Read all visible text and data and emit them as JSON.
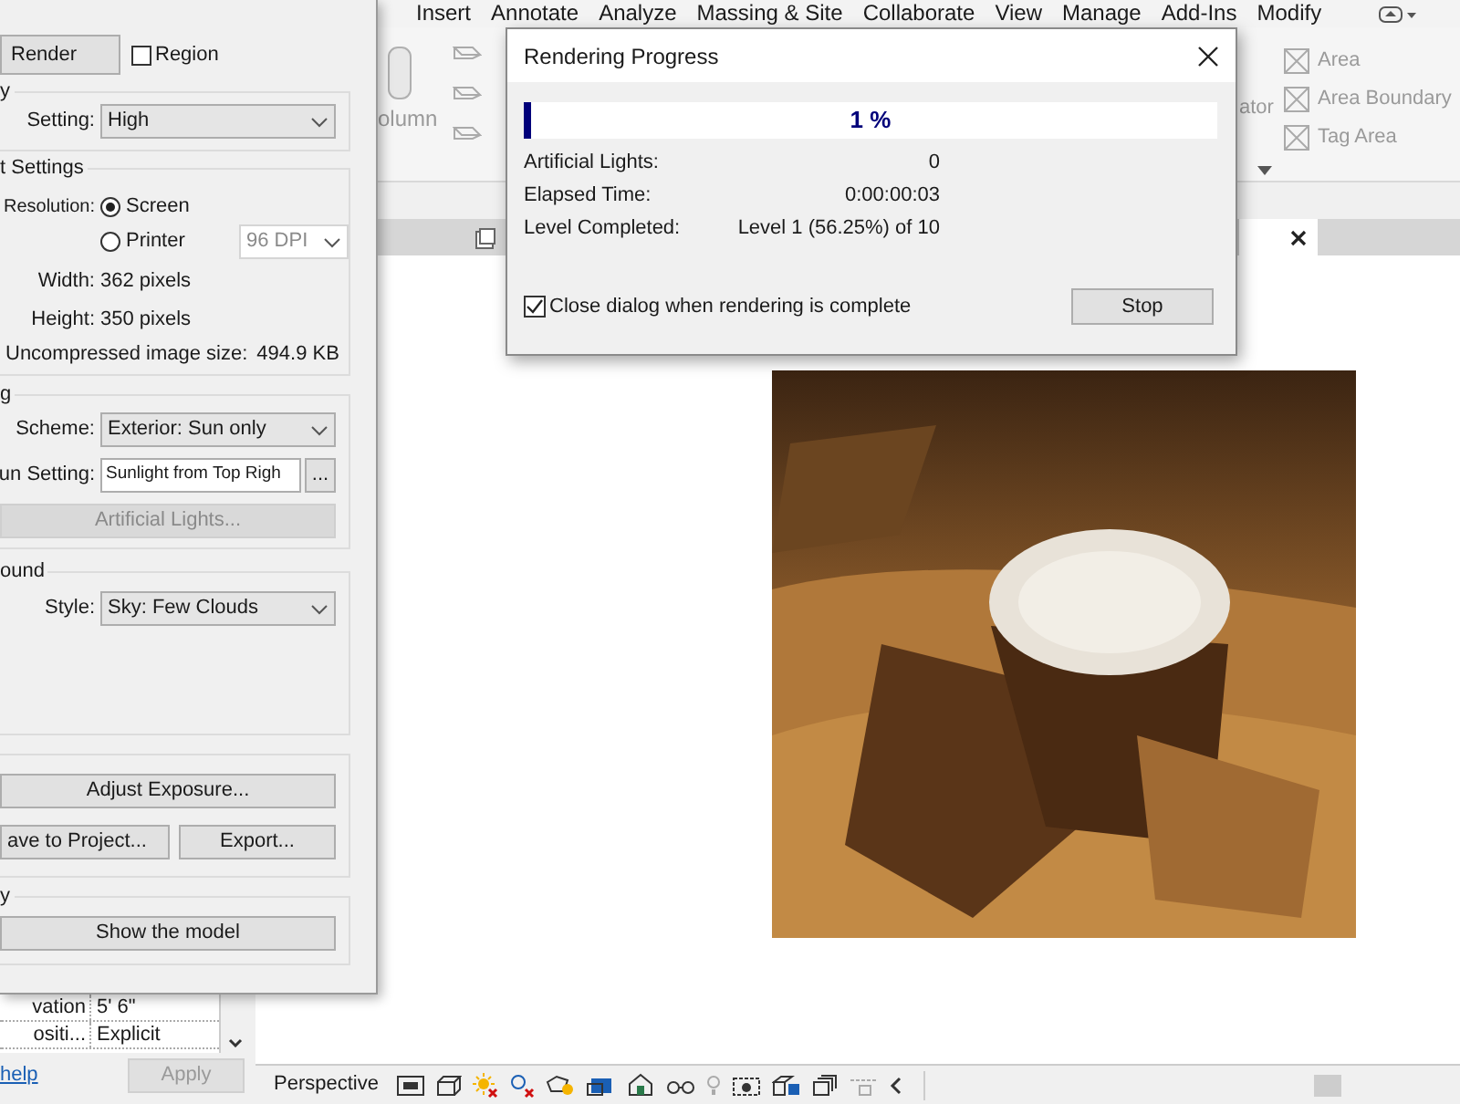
{
  "ribbon_tabs": [
    "Insert",
    "Annotate",
    "Analyze",
    "Massing & Site",
    "Collaborate",
    "View",
    "Manage",
    "Add-Ins",
    "Modify"
  ],
  "ribbon_left": {
    "column": "olumn"
  },
  "ribbon_right": {
    "cut_label": "ator",
    "area_tools": [
      "Area",
      "Area Boundary",
      "Tag Area"
    ]
  },
  "view_bar": {
    "label": "Perspective"
  },
  "properties": {
    "rows": [
      {
        "name": "vation",
        "value": "5'  6\""
      },
      {
        "name": "ositi...",
        "value": "Explicit"
      }
    ],
    "help_link": "help",
    "apply": {
      "label": "Apply",
      "disabled": true
    }
  },
  "render_dialog": {
    "render_button": "Render",
    "region": {
      "label": "Region",
      "checked": false
    },
    "quality": {
      "title": "y",
      "setting_label": "Setting:",
      "setting": "High"
    },
    "output": {
      "title": "t Settings",
      "resolution_label": "Resolution:",
      "options": [
        {
          "label": "Screen",
          "selected": true
        },
        {
          "label": "Printer",
          "selected": false
        }
      ],
      "dpi": {
        "value": "96 DPI",
        "disabled": true
      },
      "width_label": "Width:",
      "width": "362 pixels",
      "height_label": "Height:",
      "height": "350 pixels",
      "size_label": "Uncompressed image size:",
      "size": "494.9 KB"
    },
    "lighting": {
      "title": "g",
      "scheme_label": "Scheme:",
      "scheme": "Exterior: Sun only",
      "sun_label": "un Setting:",
      "sun": "Sunlight from Top Righ",
      "browse": "...",
      "artificial_lights": {
        "label": "Artificial Lights...",
        "disabled": true
      }
    },
    "background": {
      "title": "ound",
      "style_label": "Style:",
      "style": "Sky: Few Clouds"
    },
    "image": {
      "buttons": [
        "Adjust Exposure...",
        "ave to Project...",
        "Export..."
      ]
    },
    "display": {
      "title": "y",
      "button": "Show the model"
    }
  },
  "progress_dialog": {
    "title": "Rendering Progress",
    "progress": {
      "level": 0.01,
      "text": "1 %"
    },
    "rows": [
      {
        "label": "Artificial Lights:",
        "value": "0"
      },
      {
        "label": "Elapsed Time:",
        "value": "0:00:00:03"
      },
      {
        "label": "Level Completed:",
        "value": "Level 1 (56.25%) of 10"
      }
    ],
    "close_when_complete": {
      "label": "Close dialog when rendering is complete",
      "checked": true
    },
    "stop_button": "Stop"
  }
}
